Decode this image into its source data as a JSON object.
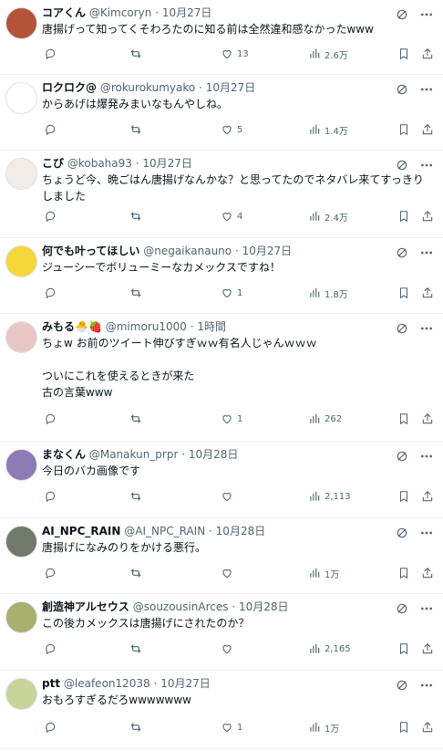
{
  "replies": [
    {
      "name": "コアくん",
      "emoji": "",
      "handle": "@Kimcoryn",
      "time": "10月27日",
      "text": "唐揚げって知ってくそわろたのに知る前は全然違和感なかったwww",
      "likes": "13",
      "views": "2.6万",
      "avatar_color": "#b5533a"
    },
    {
      "name": "ロクロク@",
      "emoji": "",
      "handle": "@rokurokumyako",
      "time": "10月27日",
      "text": "からあげは爆発みまいなもんやしね。",
      "likes": "5",
      "views": "1.4万",
      "avatar_color": "#ffffff"
    },
    {
      "name": "こび",
      "emoji": "",
      "handle": "@kobaha93",
      "time": "10月27日",
      "text": "ちょうど今、晩ごはん唐揚げなんかな？と思ってたのでネタバレ来てすっきりしました",
      "likes": "4",
      "views": "2.4万",
      "avatar_color": "#f3ece6"
    },
    {
      "name": "何でも叶ってほしい",
      "emoji": "",
      "handle": "@negaikanauno",
      "time": "10月27日",
      "text": "ジューシーでボリューミーなカメックスですね！",
      "likes": "1",
      "views": "1.8万",
      "avatar_color": "#f5d73a"
    },
    {
      "name": "みもる",
      "emoji": "🐣🍓",
      "handle": "@mimoru1000",
      "time": "1時間",
      "text": "ちょw お前のツイート伸びすぎｗｗ有名人じゃんｗｗｗ\n\nついにこれを使えるときが来た\n古の言葉www",
      "likes": "1",
      "views": "262",
      "avatar_color": "#e9c7c7"
    },
    {
      "name": "まなくん",
      "emoji": "",
      "handle": "@Manakun_prpr",
      "time": "10月28日",
      "text": "今日のバカ画像です",
      "likes": "",
      "views": "2,113",
      "avatar_color": "#8e7ab5"
    },
    {
      "name": "AI_NPC_RAIN",
      "emoji": "",
      "handle": "@AI_NPC_RAIN",
      "time": "10月28日",
      "text": "唐揚げになみのりをかける悪行。",
      "likes": "",
      "views": "1万",
      "avatar_color": "#6f7a6a"
    },
    {
      "name": "創造神アルセウス",
      "emoji": "",
      "handle": "@souzousinArces",
      "time": "10月28日",
      "text": "この後カメックスは唐揚げにされたのか？",
      "likes": "",
      "views": "2,165",
      "avatar_color": "#a8b070"
    },
    {
      "name": "ptt",
      "emoji": "",
      "handle": "@leafeon12038",
      "time": "10月27日",
      "text": "おもろすぎるだろwwwwwww",
      "likes": "1",
      "views": "1万",
      "avatar_color": "#c7d49a"
    }
  ]
}
